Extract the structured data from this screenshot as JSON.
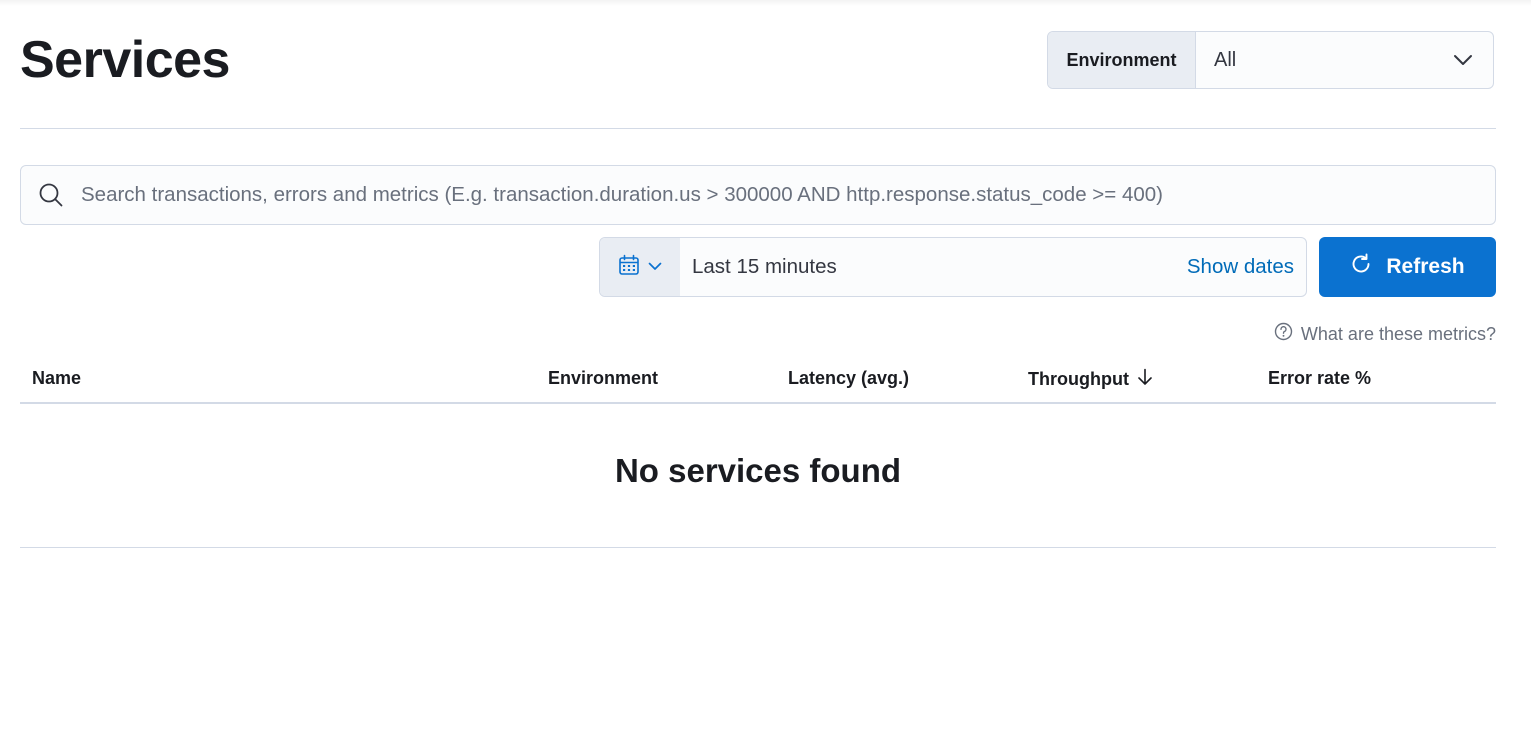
{
  "page": {
    "title": "Services"
  },
  "environment_filter": {
    "label": "Environment",
    "value": "All"
  },
  "search": {
    "placeholder": "Search transactions, errors and metrics (E.g. transaction.duration.us > 300000 AND http.response.status_code >= 400)"
  },
  "date_picker": {
    "range_label": "Last 15 minutes",
    "show_dates_label": "Show dates"
  },
  "refresh": {
    "label": "Refresh"
  },
  "metrics_help": {
    "label": "What are these metrics?"
  },
  "table": {
    "columns": [
      "Name",
      "Environment",
      "Latency (avg.)",
      "Throughput",
      "Error rate %"
    ],
    "sorted_column": "Throughput",
    "sort_direction": "descending",
    "empty_message": "No services found"
  },
  "colors": {
    "primary": "#0b72d0",
    "link": "#006bb8",
    "border": "#d3dae6",
    "text": "#1a1c21",
    "subdued_text": "#69707d"
  },
  "icons": {
    "environment_dropdown": "chevron-down-icon",
    "search": "search-icon",
    "quick_menu": "calendar-icon",
    "refresh": "refresh-icon",
    "help": "question-circle-icon",
    "sort": "arrow-down-icon"
  }
}
